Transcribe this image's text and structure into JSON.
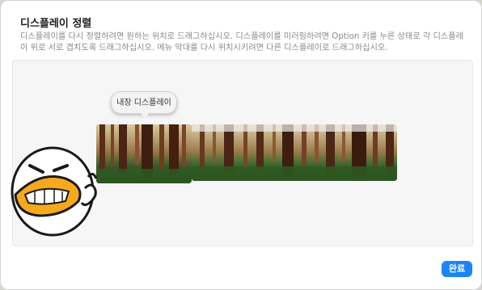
{
  "dialog": {
    "title": "디스플레이 정렬",
    "description": "디스플레이를 다시 정렬하려면 원하는 위치로 드래그하십시오. 디스플레이를 미러링하려면 Option 키를 누른 상태로 각 디스플레이 위로 서로 겹치도록 드래그하십시오. 메뉴 막대를 다시 위치시키려면 다른 디스플레이로 드래그하십시오.",
    "builtin_display_label": "내장 디스플레이",
    "done_label": "완료"
  },
  "colors": {
    "accent": "#1a86f5",
    "arrangement_bg": "#f6f6f6"
  },
  "icons": {
    "sticker": "kakao-apeach-thumbs-up-sticker"
  }
}
